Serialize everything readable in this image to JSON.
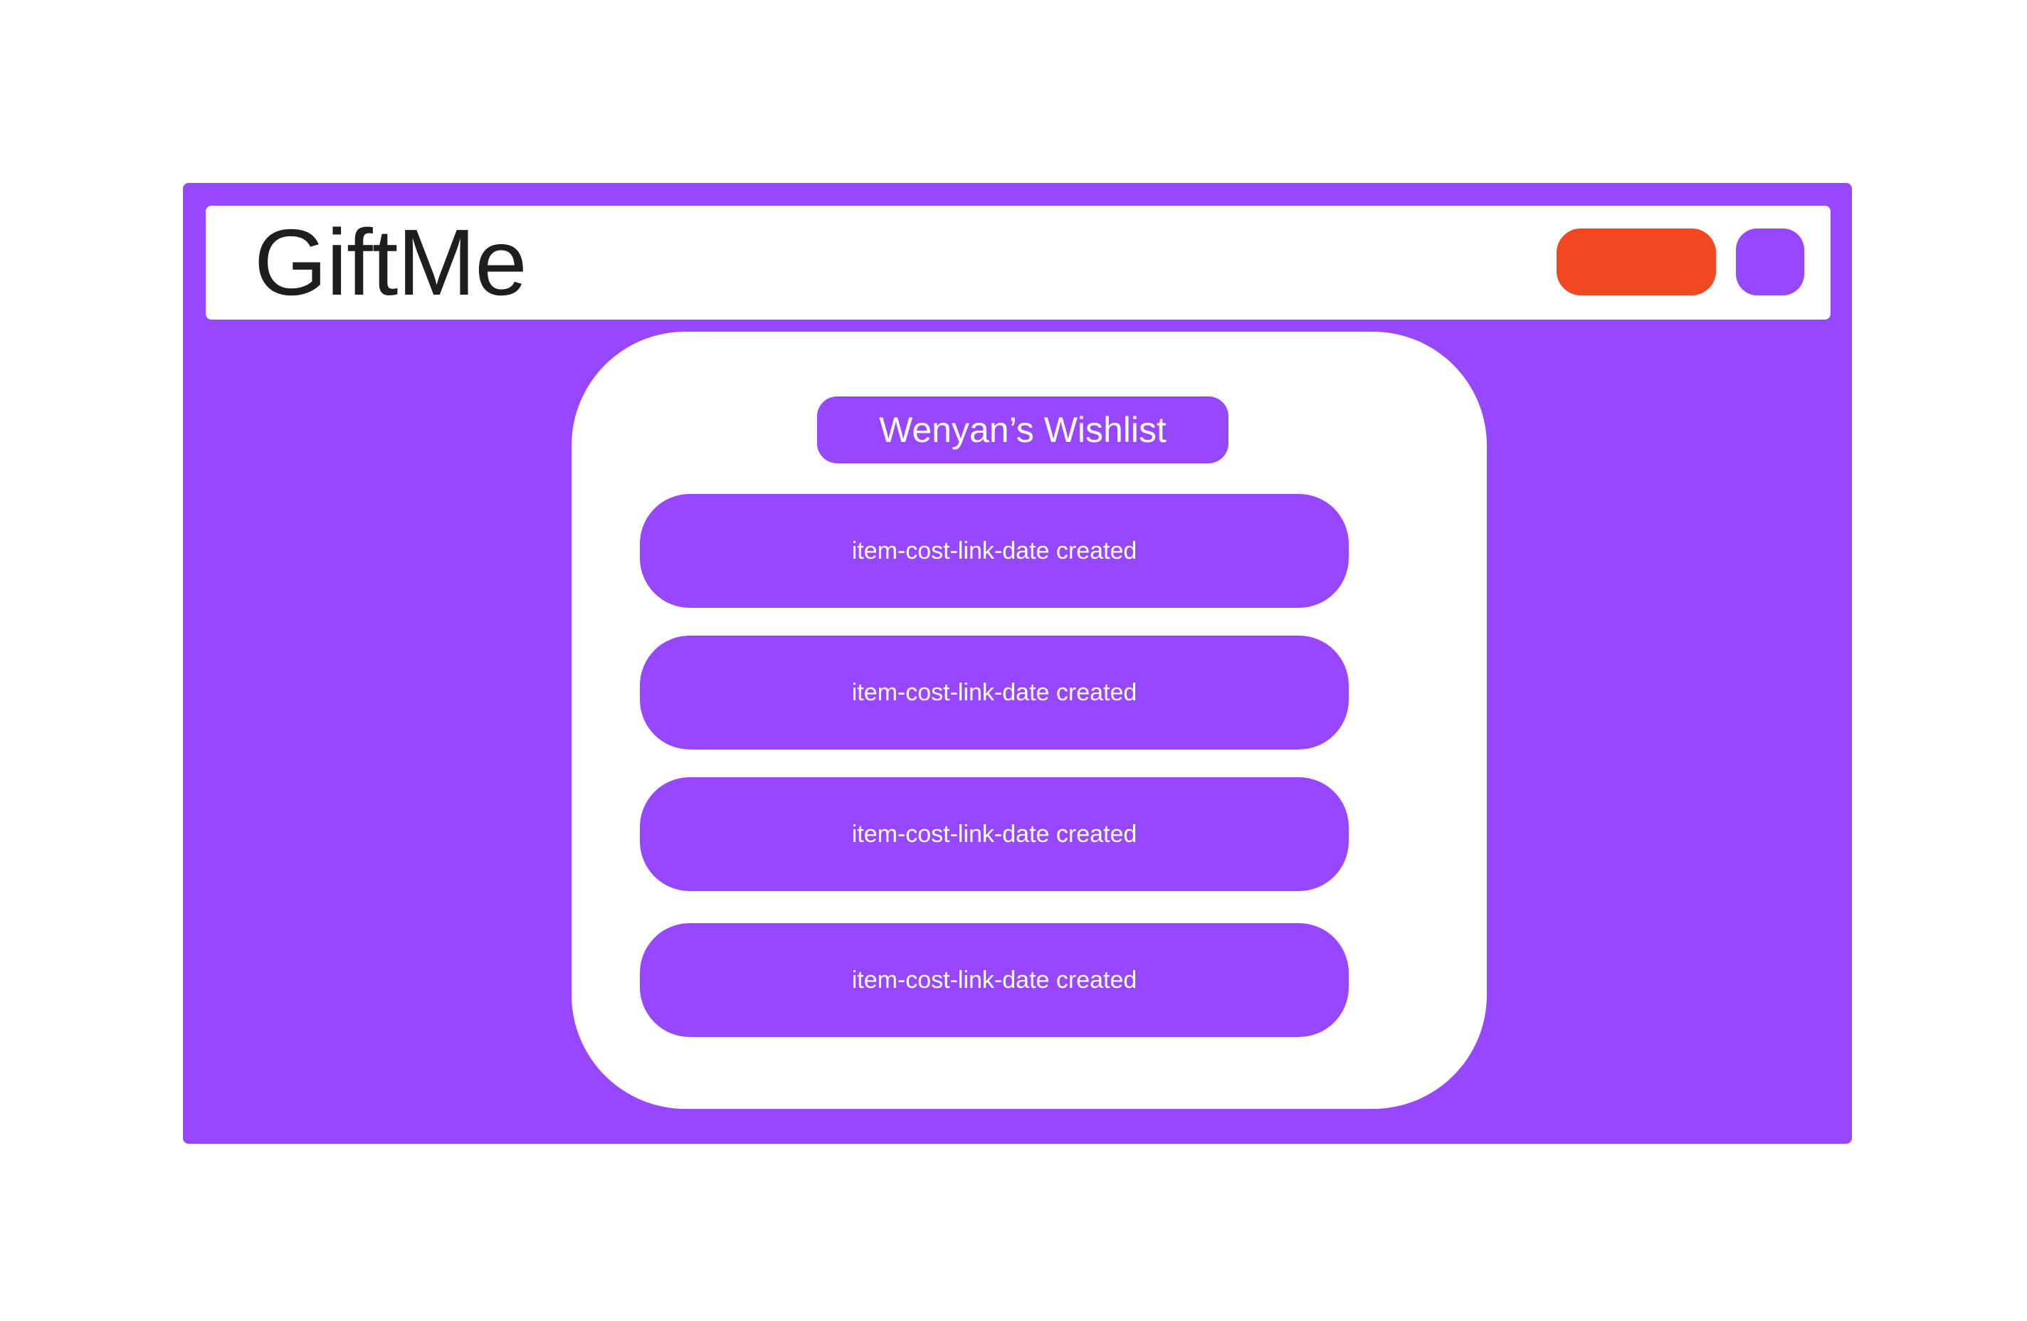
{
  "header": {
    "brand": "GiftMe",
    "primary_button_color": "#f24822",
    "secondary_button_color": "#9747ff"
  },
  "wishlist": {
    "title": "Wenyan’s Wishlist",
    "items": [
      {
        "label": "item-cost-link-date created"
      },
      {
        "label": "item-cost-link-date created"
      },
      {
        "label": "item-cost-link-date created"
      },
      {
        "label": "item-cost-link-date created"
      }
    ]
  },
  "colors": {
    "accent": "#9747ff",
    "background": "#ffffff",
    "text_dark": "#1e1e1e",
    "text_light": "#ffffff"
  }
}
